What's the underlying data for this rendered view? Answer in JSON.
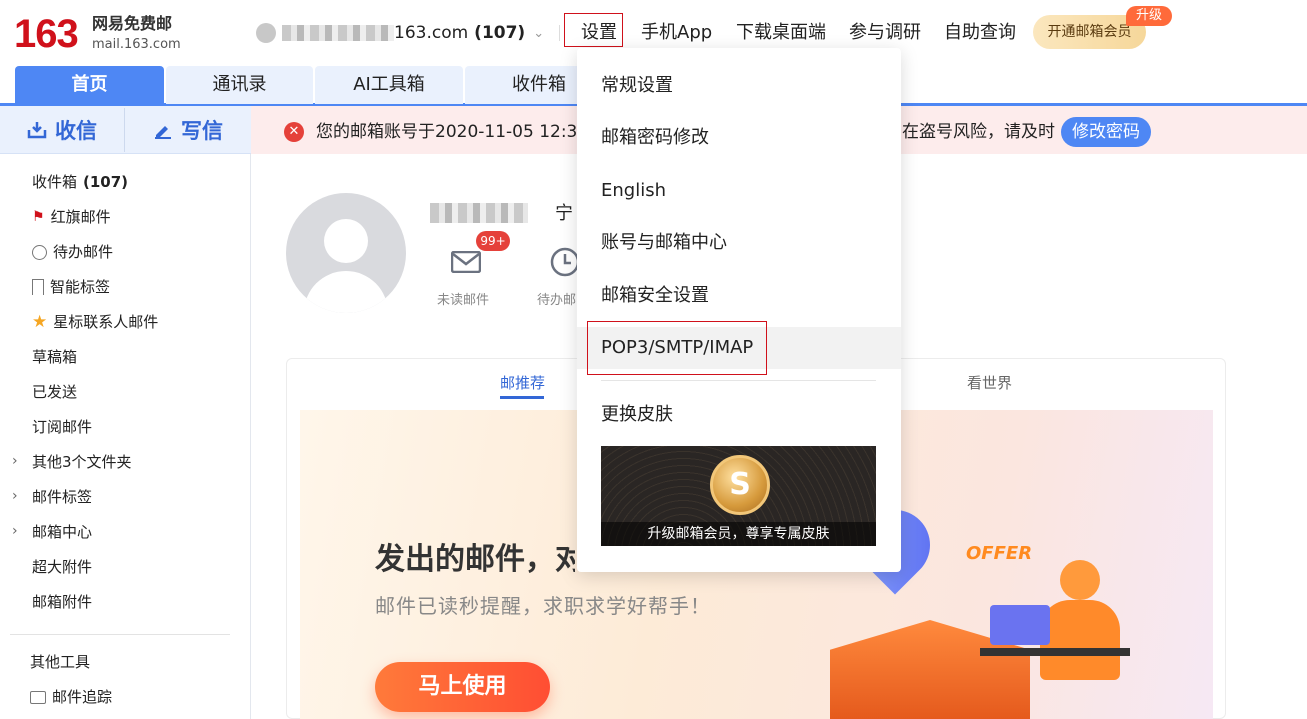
{
  "header": {
    "logo_number": "163",
    "logo_cn": "网易免费邮",
    "logo_en": "mail.163.com",
    "account_domain": "163.com",
    "account_count": "(107)",
    "links": [
      "设置",
      "手机App",
      "下载桌面端",
      "参与调研",
      "自助查询"
    ],
    "vip_label": "开通邮箱会员",
    "vip_badge": "升级"
  },
  "tabs": [
    "首页",
    "通讯录",
    "AI工具箱",
    "收件箱"
  ],
  "sidebar": {
    "receive_label": "收信",
    "write_label": "写信",
    "items": [
      {
        "label": "收件箱",
        "count": "(107)"
      },
      {
        "label": "红旗邮件"
      },
      {
        "label": "待办邮件"
      },
      {
        "label": "智能标签"
      },
      {
        "label": "星标联系人邮件"
      },
      {
        "label": "草稿箱"
      },
      {
        "label": "已发送"
      },
      {
        "label": "订阅邮件"
      },
      {
        "label": "其他3个文件夹"
      },
      {
        "label": "邮件标签"
      },
      {
        "label": "邮箱中心"
      },
      {
        "label": "超大附件"
      },
      {
        "label": "邮箱附件"
      },
      {
        "label": "其他工具"
      },
      {
        "label": "邮件追踪"
      }
    ]
  },
  "alert": {
    "text_left": "您的邮箱账号于2020-11-05 12:3",
    "text_right": "在盗号风险，请及时",
    "button": "修改密码"
  },
  "profile": {
    "name_tail": "宁",
    "unread_badge": "99+",
    "unread_label": "未读邮件",
    "todo_label": "待办邮"
  },
  "card": {
    "tab_recommend": "邮推荐",
    "tab_world": "看世界",
    "promo_title": "发出的邮件，对",
    "promo_subtitle": "邮件已读秒提醒，求职求学好帮手！",
    "promo_button": "马上使用",
    "offer": "OFFER"
  },
  "settings_menu": {
    "items": [
      "常规设置",
      "邮箱密码修改",
      "English",
      "账号与邮箱中心",
      "邮箱安全设置",
      "POP3/SMTP/IMAP",
      "更换皮肤"
    ],
    "skin_caption": "升级邮箱会员，尊享专属皮肤",
    "skin_coin": "S"
  },
  "colors": {
    "brand_red": "#d0111b",
    "accent_blue": "#4e87f4",
    "alert_red": "#e5413a"
  }
}
